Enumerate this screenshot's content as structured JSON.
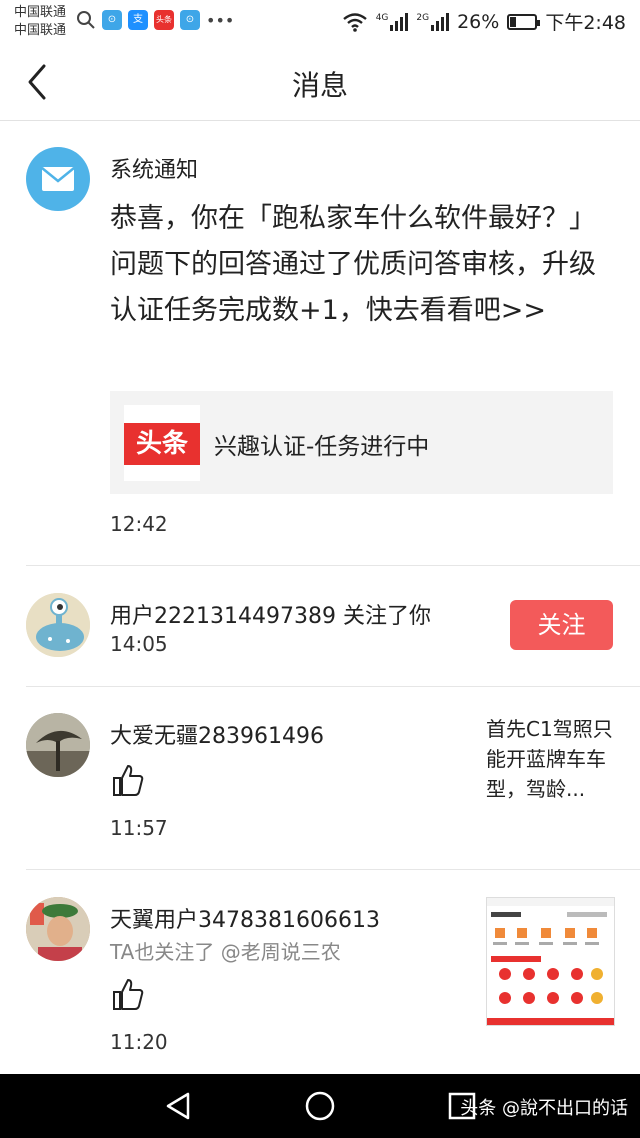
{
  "status_bar": {
    "carrier_1": "中国联通",
    "carrier_2": "中国联通",
    "network_1": "4G",
    "network_2": "2G",
    "battery_percent": "26%",
    "battery_level": 0.26,
    "time": "下午2:48"
  },
  "header": {
    "title": "消息",
    "back_icon": "chevron-left-icon"
  },
  "messages": {
    "system": {
      "sender": "系统通知",
      "body": "恭喜，你在「跑私家车什么软件最好？」问题下的回答通过了优质问答审核，升级认证任务完成数+1，快去看看吧>>",
      "card_logo": "头条",
      "card_text": "兴趣认证-任务进行中",
      "time": "12:42"
    },
    "follow": {
      "text": "用户2221314497389 关注了你",
      "time": "14:05",
      "button": "关注"
    },
    "like1": {
      "name": "大爱无疆283961496",
      "preview": "首先C1驾照只能开蓝牌车车型，驾龄...",
      "time": "11:57"
    },
    "like2": {
      "name": "天翼用户3478381606613",
      "sub": "TA也关注了 @老周说三农",
      "time": "11:20"
    }
  },
  "nav_bar": {
    "watermark": "头条 @說不出口的话"
  },
  "colors": {
    "accent": "#f35a5a",
    "brand_red": "#e8312f",
    "system_avatar": "#4fb3e8"
  }
}
